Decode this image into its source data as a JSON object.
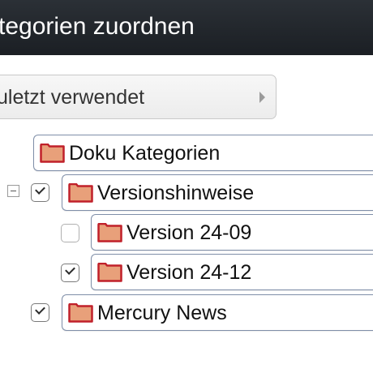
{
  "header": {
    "title": "tegorien zuordnen"
  },
  "recent": {
    "label": "uletzt verwendet",
    "arrow_icon": "chevron-right-icon"
  },
  "folder_colors": {
    "fill": "#e8a07a",
    "stroke": "#c0202a"
  },
  "tree": [
    {
      "label": "Doku Kategorien",
      "checkbox": null,
      "icon": "folder-icon"
    },
    {
      "label": "Versionshinweise",
      "checkbox": "checked",
      "expander": "collapse-icon",
      "icon": "folder-icon"
    },
    {
      "label": "Version 24-09",
      "checkbox": "unchecked",
      "icon": "folder-icon"
    },
    {
      "label": "Version 24-12",
      "checkbox": "checked",
      "icon": "folder-icon"
    },
    {
      "label": "Mercury News",
      "checkbox": "checked",
      "icon": "folder-icon"
    }
  ]
}
